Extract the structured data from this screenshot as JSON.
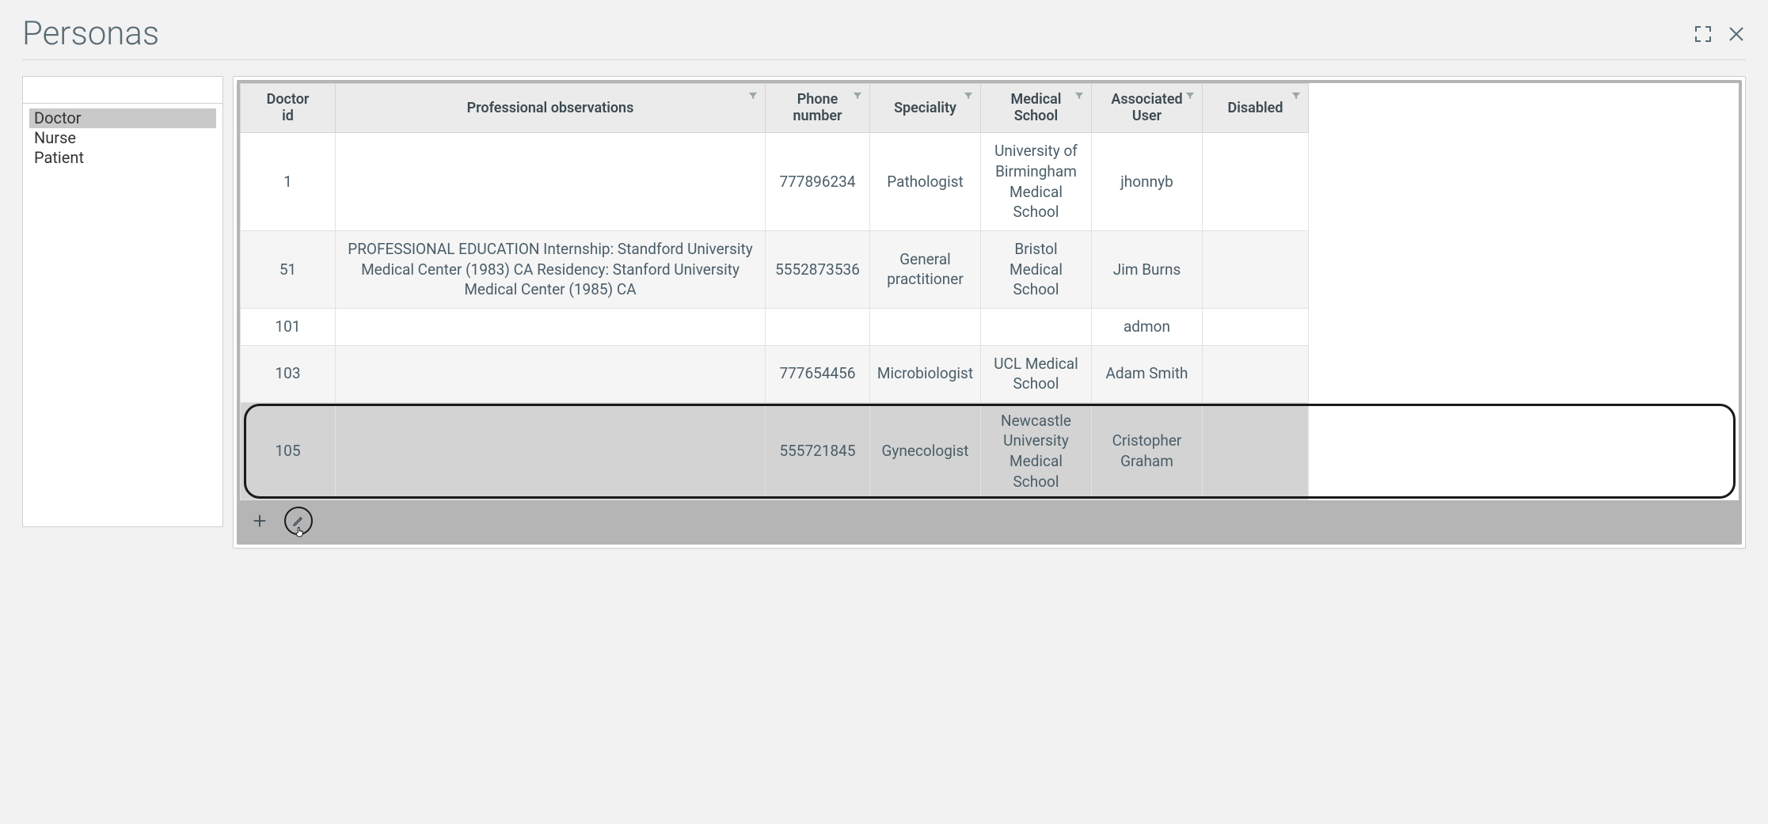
{
  "header": {
    "title": "Personas"
  },
  "sidebar": {
    "search_placeholder": "",
    "items": [
      {
        "label": "Doctor",
        "selected": true
      },
      {
        "label": "Nurse",
        "selected": false
      },
      {
        "label": "Patient",
        "selected": false
      }
    ]
  },
  "table": {
    "columns": [
      {
        "key": "id",
        "label": "Doctor\nid",
        "filter": false
      },
      {
        "key": "obs",
        "label": "Professional observations",
        "filter": true
      },
      {
        "key": "phone",
        "label": "Phone\nnumber",
        "filter": true
      },
      {
        "key": "spec",
        "label": "Speciality",
        "filter": true
      },
      {
        "key": "school",
        "label": "Medical\nSchool",
        "filter": true
      },
      {
        "key": "user",
        "label": "Associated\nUser",
        "filter": true
      },
      {
        "key": "dis",
        "label": "Disabled",
        "filter": true
      }
    ],
    "rows": [
      {
        "id": "1",
        "obs": "",
        "phone": "777896234",
        "spec": "Pathologist",
        "school": "University of Birmingham Medical School",
        "user": "jhonnyb",
        "dis": "",
        "selected": false
      },
      {
        "id": "51",
        "obs": "PROFESSIONAL EDUCATION Internship: Standford University Medical Center (1983) CA Residency: Stanford University Medical Center (1985) CA",
        "phone": "5552873536",
        "spec": "General practitioner",
        "school": "Bristol Medical School",
        "user": "Jim Burns",
        "dis": "",
        "selected": false
      },
      {
        "id": "101",
        "obs": "",
        "phone": "",
        "spec": "",
        "school": "",
        "user": "admon",
        "dis": "",
        "selected": false
      },
      {
        "id": "103",
        "obs": "",
        "phone": "777654456",
        "spec": "Microbiologist",
        "school": "UCL Medical School",
        "user": "Adam Smith",
        "dis": "",
        "selected": false
      },
      {
        "id": "105",
        "obs": "",
        "phone": "555721845",
        "spec": "Gynecologist",
        "school": "Newcastle University Medical School",
        "user": "Cristopher Graham",
        "dis": "",
        "selected": true
      }
    ]
  }
}
